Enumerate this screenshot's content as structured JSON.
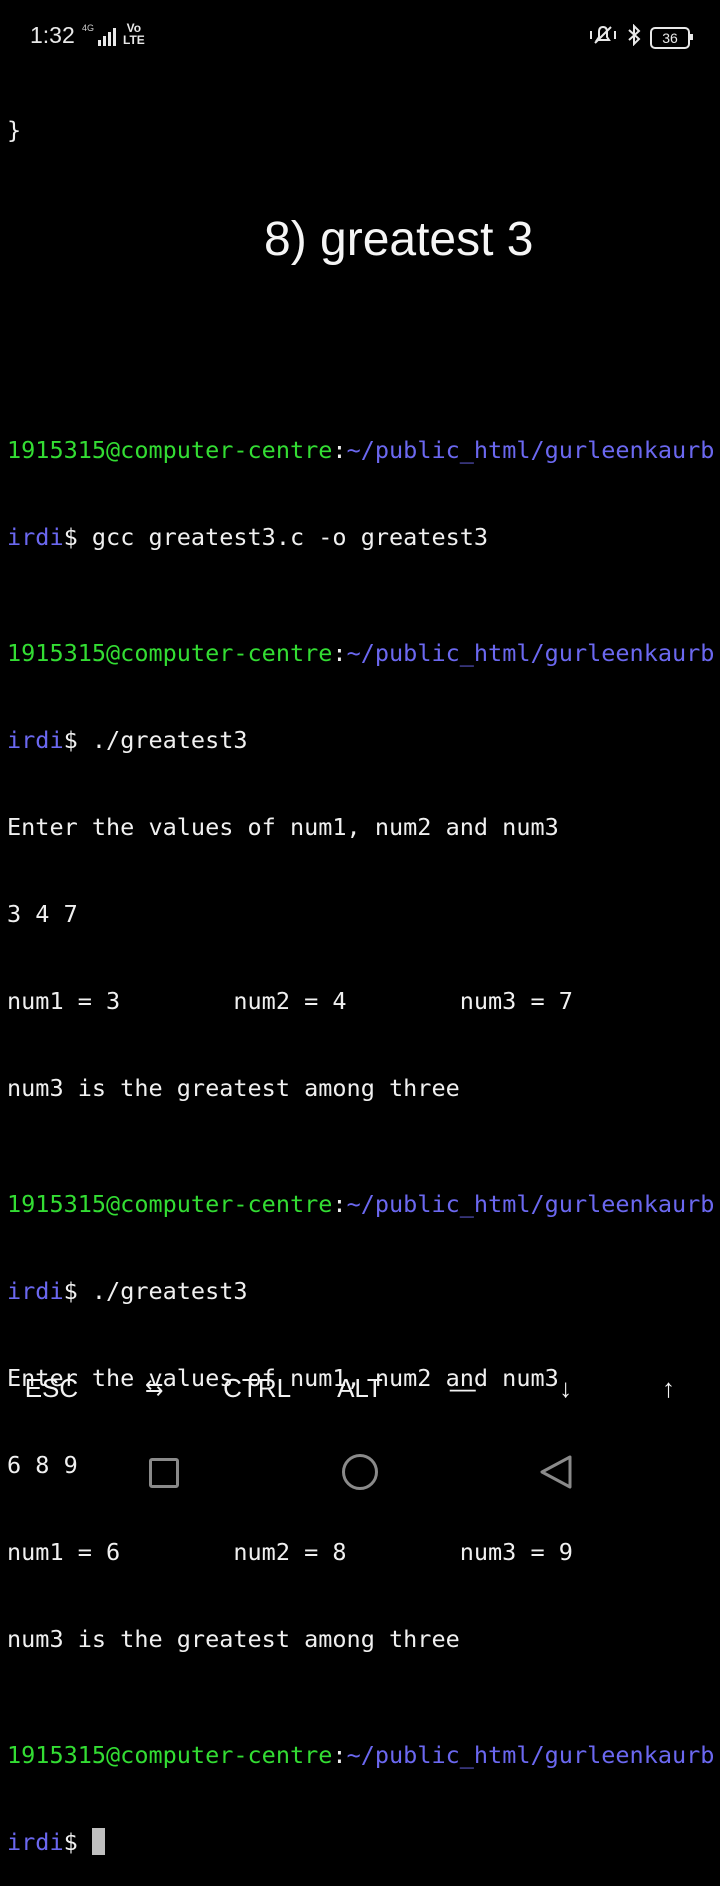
{
  "status_bar": {
    "time": "1:32",
    "network_small": "4G",
    "volte_line1": "Vo",
    "volte_line2": "LTE",
    "battery_level": "36",
    "icons": [
      "silent-mode-icon",
      "bluetooth-icon",
      "battery-icon"
    ]
  },
  "terminal_top": {
    "closing_brace": "}"
  },
  "heading": "8) greatest 3",
  "terminal": {
    "prompt_user": "1915315@computer-centre",
    "prompt_path_part1": "~/public_html/gurleenkaurb",
    "prompt_path_part2": "irdi",
    "prompt_symbol": "$",
    "cmd1": " gcc greatest3.c -o greatest3",
    "cmd2": " ./greatest3",
    "cmd3": " ./greatest3",
    "out1_prompt": "Enter the values of num1, num2 and num3",
    "out1_input": "3 4 7",
    "out1_values": "num1 = 3        num2 = 4        num3 = 7",
    "out1_result": "num3 is the greatest among three",
    "out2_prompt": "Enter the values of num1, num2 and num3",
    "out2_input": "6 8 9",
    "out2_values": "num1 = 6        num2 = 8        num3 = 9",
    "out2_result": "num3 is the greatest among three"
  },
  "extra_keys": {
    "esc": "ESC",
    "tab": "⇆",
    "ctrl": "CTRL",
    "alt": "ALT",
    "dash": "—",
    "down": "↓",
    "up": "↑"
  },
  "colors": {
    "prompt_user": "#33dd33",
    "prompt_path": "#6b68f0",
    "text": "#f0f0f0",
    "background": "#000000"
  }
}
